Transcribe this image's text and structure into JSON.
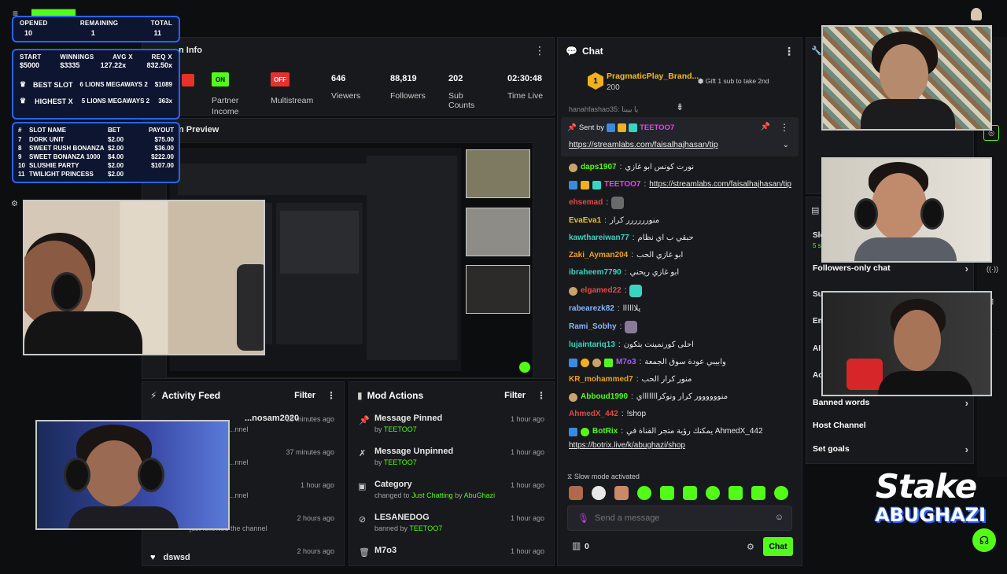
{
  "stream_info": {
    "title_fragment": "n Info",
    "tile_on": "ON",
    "tile_off": "OFF",
    "partner_income": "Partner Income",
    "multistream": "Multistream",
    "stats": [
      {
        "value": "646",
        "label": "Viewers"
      },
      {
        "value": "88,819",
        "label": "Followers"
      },
      {
        "value": "202",
        "label": "Sub Counts"
      },
      {
        "value": "02:30:48",
        "label": "Time Live"
      }
    ]
  },
  "preview": {
    "title_fragment": "n Preview"
  },
  "slot_overlay": {
    "opened_label": "OPENED",
    "remaining_label": "REMAINING",
    "total_label": "TOTAL",
    "opened": "10",
    "remaining": "1",
    "total": "11",
    "start_label": "START",
    "winnings_label": "WINNINGS",
    "avgx_label": "AVG X",
    "reqx_label": "REQ X",
    "start": "$5000",
    "winnings": "$3335",
    "avgx": "127.22x",
    "reqx": "832.50x",
    "best_label": "BEST SLOT",
    "best_name": "6 LIONS MEGAWAYS 2",
    "best_value": "$1089",
    "highest_label": "HIGHEST X",
    "highest_name": "5 LIONS MEGAWAYS 2",
    "highest_value": "363x",
    "table_headers": [
      "#",
      "SLOT NAME",
      "BET",
      "PAYOUT"
    ],
    "slots": [
      {
        "n": "7",
        "name": "DORK UNIT",
        "bet": "$2.00",
        "payout": "$75.00"
      },
      {
        "n": "8",
        "name": "SWEET RUSH BONANZA",
        "bet": "$2.00",
        "payout": "$36.00"
      },
      {
        "n": "9",
        "name": "SWEET BONANZA 1000",
        "bet": "$4.00",
        "payout": "$222.00"
      },
      {
        "n": "10",
        "name": "SLUSHIE PARTY",
        "bet": "$2.00",
        "payout": "$107.00"
      },
      {
        "n": "11",
        "name": "TWILIGHT PRINCESS",
        "bet": "$2.00",
        "payout": ""
      }
    ]
  },
  "chat": {
    "title": "Chat",
    "pinned_user": "PragmaticPlay_Brand...",
    "pinned_amount": "200",
    "gift_text": "Gift 1 sub to take 2nd",
    "partial_top": "hanahfashao35: يا بيبنا",
    "sent_by_label": "Sent by",
    "sent_by_user": "TEETOO7",
    "pinned_link": "https://streamlabs.com/faisalhajhasan/tip",
    "messages": [
      {
        "user": "daps1907",
        "color": "#53fc18",
        "text": "نورت كونس ابو غازي"
      },
      {
        "user": "TEETOO7",
        "color": "#e04ae0",
        "text": "https://streamlabs.com/faisalhajhasan/tip",
        "link": true
      },
      {
        "user": "ehsemad",
        "color": "#e04a4a",
        "text": ""
      },
      {
        "user": "EvaEva1",
        "color": "#f0c020",
        "text": "منورررررر كرار"
      },
      {
        "user": "kawthareiwan77",
        "color": "#3ad4c4",
        "text": "حبقي ب اي نظام"
      },
      {
        "user": "Zaki_Ayman204",
        "color": "#f0a020",
        "text": "ابو غازي الحب"
      },
      {
        "user": "ibraheem7790",
        "color": "#3ad4c4",
        "text": "ابو غازي ريحني"
      },
      {
        "user": "elgamed22",
        "color": "#e04a4a",
        "text": ""
      },
      {
        "user": "rabearezk82",
        "color": "#8ab4ff",
        "text": "يلاااااا"
      },
      {
        "user": "Rami_Sobhy",
        "color": "#8ab4ff",
        "text": ""
      },
      {
        "user": "lujaintariq13",
        "color": "#3ad4c4",
        "text": "احلى كورنمينت بتكون"
      },
      {
        "user": "M7o3",
        "color": "#a060ff",
        "text": "وابيبي عودة سوق الجمعة"
      },
      {
        "user": "KR_mohammed7",
        "color": "#f0a020",
        "text": "منور كرار الحب"
      },
      {
        "user": "Abboud1990",
        "color": "#53fc18",
        "text": "منوووووور كرار ونوكراااااااي"
      },
      {
        "user": "AhmedX_442",
        "color": "#e04a4a",
        "text": "!shop"
      },
      {
        "user": "BotRix",
        "color": "#53fc18",
        "text": "يمكنك رؤية متجر القناة في AhmedX_442",
        "link2": "https://botrix.live/k/abughazi/shop"
      }
    ],
    "slow_mode": "Slow mode activated",
    "input_placeholder": "Send a message",
    "points": "0",
    "send_label": "Chat"
  },
  "activity_feed": {
    "title": "Activity Feed",
    "filter": "Filter",
    "rows": [
      {
        "user": "...nosam2020",
        "sub": "...nnel",
        "time": "25 minutes ago"
      },
      {
        "user": "",
        "sub": "...nnel",
        "time": "37 minutes ago"
      },
      {
        "user": "",
        "sub": "...nnel",
        "time": "1 hour ago"
      },
      {
        "user": "",
        "sub": "just followed the channel",
        "time": "2 hours ago"
      },
      {
        "user": "dswsd",
        "sub": "",
        "time": "2 hours ago"
      }
    ]
  },
  "mod_actions": {
    "title": "Mod Actions",
    "filter": "Filter",
    "rows": [
      {
        "action": "Message Pinned",
        "by_label": "by",
        "by": "TEETOO7",
        "time": "1 hour ago"
      },
      {
        "action": "Message Unpinned",
        "by_label": "by",
        "by": "TEETOO7",
        "time": "1 hour ago"
      },
      {
        "action": "Category",
        "changed_label": "changed to",
        "category": "Just Chatting",
        "by_label": "by",
        "by": "AbuGhazi",
        "time": "1 hour ago"
      },
      {
        "action": "LESANEDOG",
        "by_label": "banned by",
        "by": "TEETOO7",
        "time": "1 hour ago"
      },
      {
        "action": "M7o3",
        "by_label": "",
        "by": "",
        "time": "1 hour ago"
      }
    ]
  },
  "right_panel": {
    "items": [
      {
        "label": "Followers-only chat",
        "chevron": true
      },
      {
        "label": "Banned words",
        "chevron": true
      },
      {
        "label": "Host Channel",
        "chevron": false
      },
      {
        "label": "Set goals",
        "chevron": true
      }
    ],
    "partial_letters": [
      "Slo",
      "5 s",
      "Su",
      "Em",
      "AI",
      "Ac"
    ]
  },
  "brand": {
    "line1": "Stake",
    "line2": "ABUGHAZI"
  }
}
